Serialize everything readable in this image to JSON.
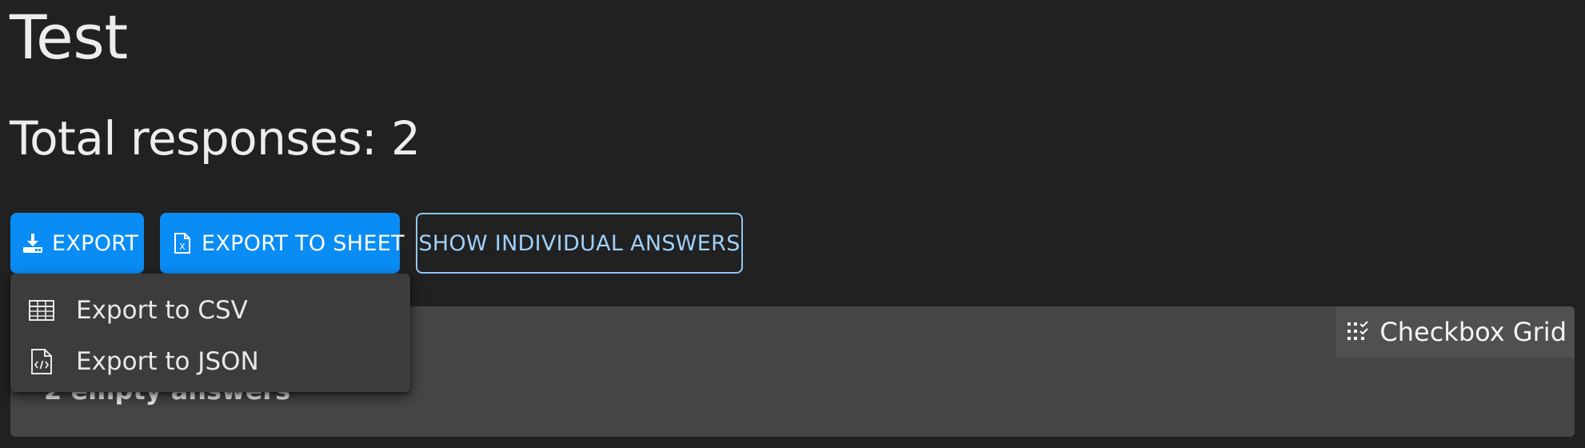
{
  "page": {
    "title": "Test",
    "total_responses": "Total responses: 2"
  },
  "toolbar": {
    "export_label": "EXPORT",
    "export_icon": "download-icon",
    "export_sheet_label": "EXPORT TO SHEET",
    "export_sheet_icon": "spreadsheet-file-icon",
    "show_individual_label": "SHOW INDIVIDUAL ANSWERS"
  },
  "export_menu": {
    "items": [
      {
        "label": "Export to CSV",
        "icon": "table-icon"
      },
      {
        "label": "Export to JSON",
        "icon": "code-file-icon"
      }
    ]
  },
  "question_card": {
    "type_label": "Checkbox Grid",
    "type_icon": "checkbox-grid-icon",
    "summary": "2 empty answers"
  },
  "colors": {
    "background": "#212121",
    "primary": "#0a8cf5",
    "outline": "#8ec8f7",
    "card": "#454545",
    "menu": "#3c3c3c"
  }
}
